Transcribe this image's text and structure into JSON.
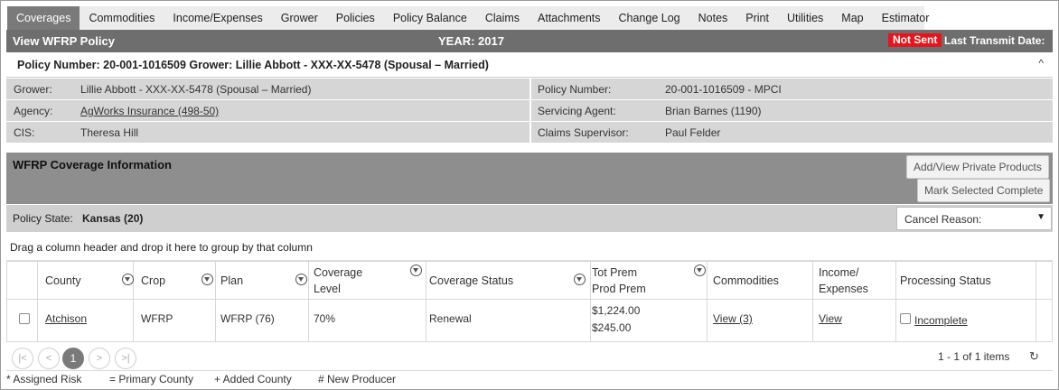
{
  "tabs": [
    "Coverages",
    "Commodities",
    "Income/Expenses",
    "Grower",
    "Policies",
    "Policy Balance",
    "Claims",
    "Attachments",
    "Change Log",
    "Notes",
    "Print",
    "Utilities",
    "Map",
    "Estimator"
  ],
  "titlebar": {
    "title": "View WFRP Policy",
    "year": "YEAR: 2017",
    "status_badge": "Not Sent",
    "transmit_label": "Last Transmit Date:",
    "badge_color": "#e8141b"
  },
  "policy_header": {
    "text": "Policy Number: 20-001-1016509 Grower: Lillie Abbott - XXX-XX-5478 (Spousal – Married)",
    "collapse_glyph": "^"
  },
  "info": {
    "grower_label": "Grower:",
    "grower_value": "Lillie Abbott - XXX-XX-5478 (Spousal – Married)",
    "agency_label": "Agency:",
    "agency_value": "AgWorks Insurance (498-50)",
    "cis_label": "CIS:",
    "cis_value": "Theresa Hill",
    "policy_number_label": "Policy Number:",
    "policy_number_value": "20-001-1016509 - MPCI",
    "servicing_agent_label": "Servicing Agent:",
    "servicing_agent_value": "Brian Barnes (1190)",
    "claims_supervisor_label": "Claims Supervisor:",
    "claims_supervisor_value": "Paul Felder"
  },
  "coverage": {
    "title": "WFRP Coverage Information",
    "btn_private_products": "Add/View Private Products",
    "btn_mark_complete": "Mark Selected Complete"
  },
  "policy_state": {
    "label": "Policy State:",
    "value": "Kansas (20)",
    "cancel_reason": "Cancel Reason:"
  },
  "group_hint": "Drag a column header and drop it here to group by that column",
  "grid": {
    "headers": {
      "county": "County",
      "crop": "Crop",
      "plan": "Plan",
      "coverage_level_1": "Coverage",
      "coverage_level_2": "Level",
      "coverage_status": "Coverage Status",
      "tot_prem": "Tot Prem",
      "prod_prem": "Prod Prem",
      "commodities": "Commodities",
      "income_1": "Income/",
      "income_2": "Expenses",
      "processing_status": "Processing Status"
    },
    "rows": [
      {
        "county": "Atchison",
        "crop": "WFRP",
        "plan": "WFRP (76)",
        "coverage_level": "70%",
        "coverage_status": "Renewal",
        "tot_prem": "$1,224.00",
        "prod_prem": "$245.00",
        "commodities": "View (3)",
        "income_expenses": "View",
        "processing_status": "Incomplete"
      }
    ]
  },
  "pager": {
    "first": "|<",
    "prev": "<",
    "page": "1",
    "next": ">",
    "last": ">|",
    "info": "1 - 1 of 1 items",
    "refresh_glyph": "↻"
  },
  "legend": {
    "assigned_risk": "* Assigned Risk",
    "primary_county": "= Primary County",
    "added_county": "+ Added County",
    "new_producer": "# New Producer"
  }
}
